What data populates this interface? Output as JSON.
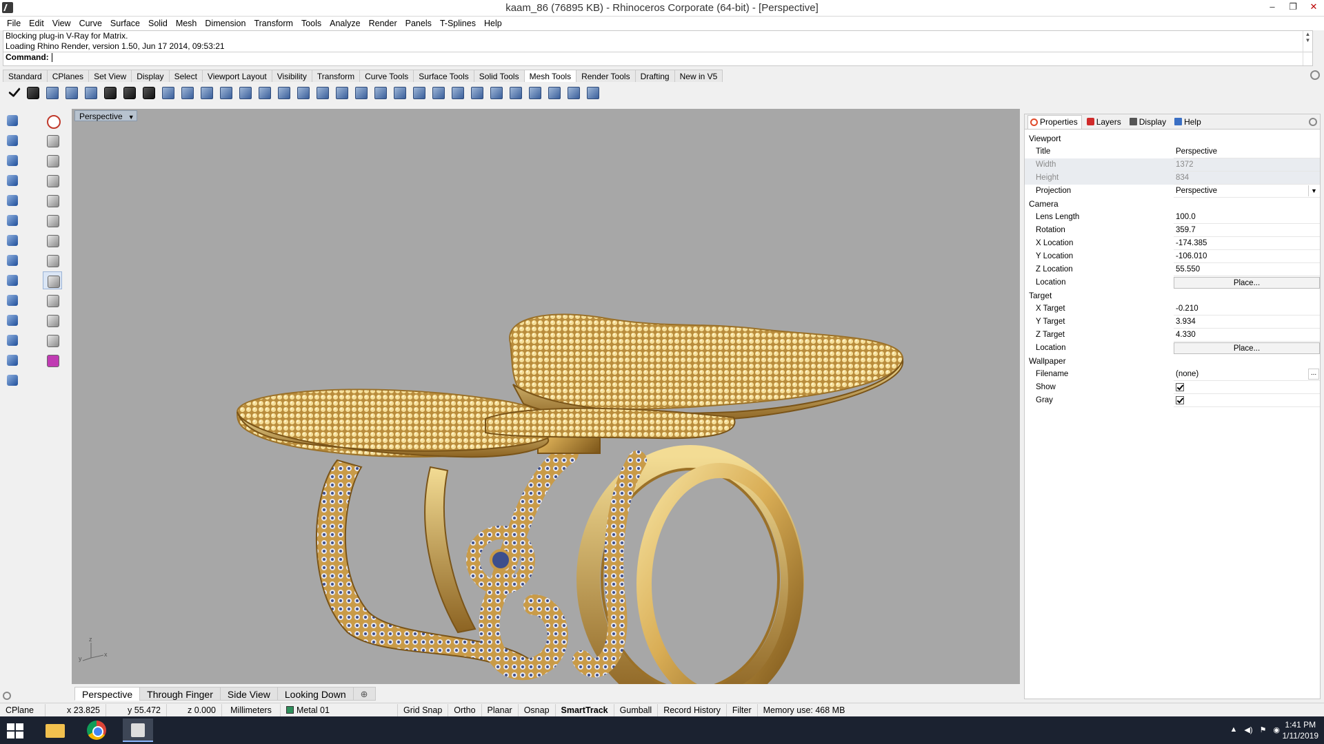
{
  "window": {
    "title": "kaam_86 (76895 KB) - Rhinoceros Corporate (64-bit) - [Perspective]",
    "minimize": "–",
    "maximize": "❐",
    "close": "✕"
  },
  "menu": [
    "File",
    "Edit",
    "View",
    "Curve",
    "Surface",
    "Solid",
    "Mesh",
    "Dimension",
    "Transform",
    "Tools",
    "Analyze",
    "Render",
    "Panels",
    "T-Splines",
    "Help"
  ],
  "command": {
    "history": [
      "Blocking plug-in V-Ray for Matrix.",
      "Loading Rhino Render, version 1.50, Jun 17 2014, 09:53:21"
    ],
    "prompt": "Command:"
  },
  "toolbar_tabs": [
    "Standard",
    "CPlanes",
    "Set View",
    "Display",
    "Select",
    "Viewport Layout",
    "Visibility",
    "Transform",
    "Curve Tools",
    "Surface Tools",
    "Solid Tools",
    "Mesh Tools",
    "Render Tools",
    "Drafting",
    "New in V5"
  ],
  "active_toolbar_tab": "Mesh Tools",
  "viewport": {
    "label": "Perspective",
    "axes": {
      "z": "z",
      "y": "y",
      "x": "x"
    }
  },
  "viewport_tabs": [
    "Perspective",
    "Through Finger",
    "Side View",
    "Looking Down"
  ],
  "viewport_tab_add": "⊕",
  "panel": {
    "tabs": [
      {
        "label": "Properties",
        "icon": "properties-icon",
        "color": "#e04a2a"
      },
      {
        "label": "Layers",
        "icon": "layers-icon",
        "color": "#d02b2b"
      },
      {
        "label": "Display",
        "icon": "display-icon",
        "color": "#555555"
      },
      {
        "label": "Help",
        "icon": "help-icon",
        "color": "#3a6fc4"
      }
    ],
    "sections": {
      "viewport": "Viewport",
      "camera": "Camera",
      "target": "Target",
      "wallpaper": "Wallpaper"
    },
    "viewport_rows": {
      "title_k": "Title",
      "title_v": "Perspective",
      "width_k": "Width",
      "width_v": "1372",
      "height_k": "Height",
      "height_v": "834",
      "projection_k": "Projection",
      "projection_v": "Perspective"
    },
    "camera_rows": {
      "lens_k": "Lens Length",
      "lens_v": "100.0",
      "rotation_k": "Rotation",
      "rotation_v": "359.7",
      "xloc_k": "X Location",
      "xloc_v": "-174.385",
      "yloc_k": "Y Location",
      "yloc_v": "-106.010",
      "zloc_k": "Z Location",
      "zloc_v": "55.550",
      "location_k": "Location",
      "place": "Place..."
    },
    "target_rows": {
      "xt_k": "X Target",
      "xt_v": "-0.210",
      "yt_k": "Y Target",
      "yt_v": "3.934",
      "zt_k": "Z Target",
      "zt_v": "4.330",
      "location_k": "Location",
      "place": "Place..."
    },
    "wallpaper_rows": {
      "filename_k": "Filename",
      "filename_v": "(none)",
      "browse": "...",
      "show_k": "Show",
      "show_checked": true,
      "gray_k": "Gray",
      "gray_checked": true
    }
  },
  "status": {
    "cplane": "CPlane",
    "x": "x 23.825",
    "y": "y 55.472",
    "z": "z 0.000",
    "units": "Millimeters",
    "layer": "Metal 01",
    "layer_color": "#2f8f5b",
    "grid_snap": "Grid Snap",
    "ortho": "Ortho",
    "planar": "Planar",
    "osnap": "Osnap",
    "smarttrack": "SmartTrack",
    "gumball": "Gumball",
    "record_history": "Record History",
    "filter": "Filter",
    "memory": "Memory use: 468 MB"
  },
  "taskbar": {
    "time": "1:41 PM",
    "date": "1/11/2019"
  },
  "colors": {
    "viewport_bg": "#a7a7a7",
    "gold_light": "#f1d98a",
    "gold_mid": "#cfa24a",
    "gold_dark": "#7a5418",
    "gem_blue": "#3d4f8c"
  }
}
